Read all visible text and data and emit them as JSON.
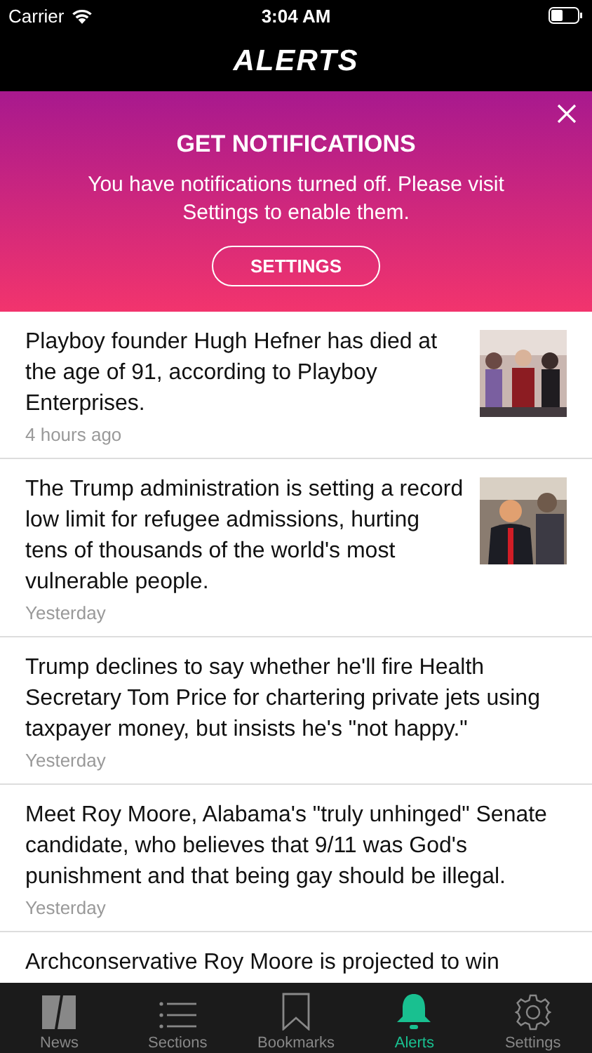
{
  "status_bar": {
    "carrier": "Carrier",
    "time": "3:04 AM"
  },
  "nav": {
    "title": "ALERTS"
  },
  "banner": {
    "title": "GET NOTIFICATIONS",
    "message": "You have notifications turned off. Please visit Settings to enable them.",
    "button": "SETTINGS"
  },
  "articles": [
    {
      "headline": "Playboy founder Hugh Hefner has died at the age of 91, according to Playboy Enterprises.",
      "time": "4 hours ago"
    },
    {
      "headline": "The Trump administration is setting a record low limit for refugee admissions, hurting tens of thousands of the world's most vulnerable people.",
      "time": "Yesterday"
    },
    {
      "headline": "Trump declines to say whether he'll fire Health Secretary Tom Price for chartering private jets using taxpayer money, but insists he's \"not happy.\"",
      "time": "Yesterday"
    },
    {
      "headline": "Meet Roy Moore, Alabama's \"truly unhinged\" Senate candidate, who believes that 9/11 was God's punishment and that being gay should be illegal.",
      "time": "Yesterday"
    },
    {
      "headline": "Archconservative Roy Moore is projected to win"
    }
  ],
  "tabs": [
    {
      "label": "News",
      "kind": "news",
      "selected": false
    },
    {
      "label": "Sections",
      "kind": "list",
      "selected": false
    },
    {
      "label": "Bookmarks",
      "kind": "bookmark",
      "selected": false
    },
    {
      "label": "Alerts",
      "kind": "bell",
      "selected": true
    },
    {
      "label": "Settings",
      "kind": "gear",
      "selected": false
    }
  ]
}
